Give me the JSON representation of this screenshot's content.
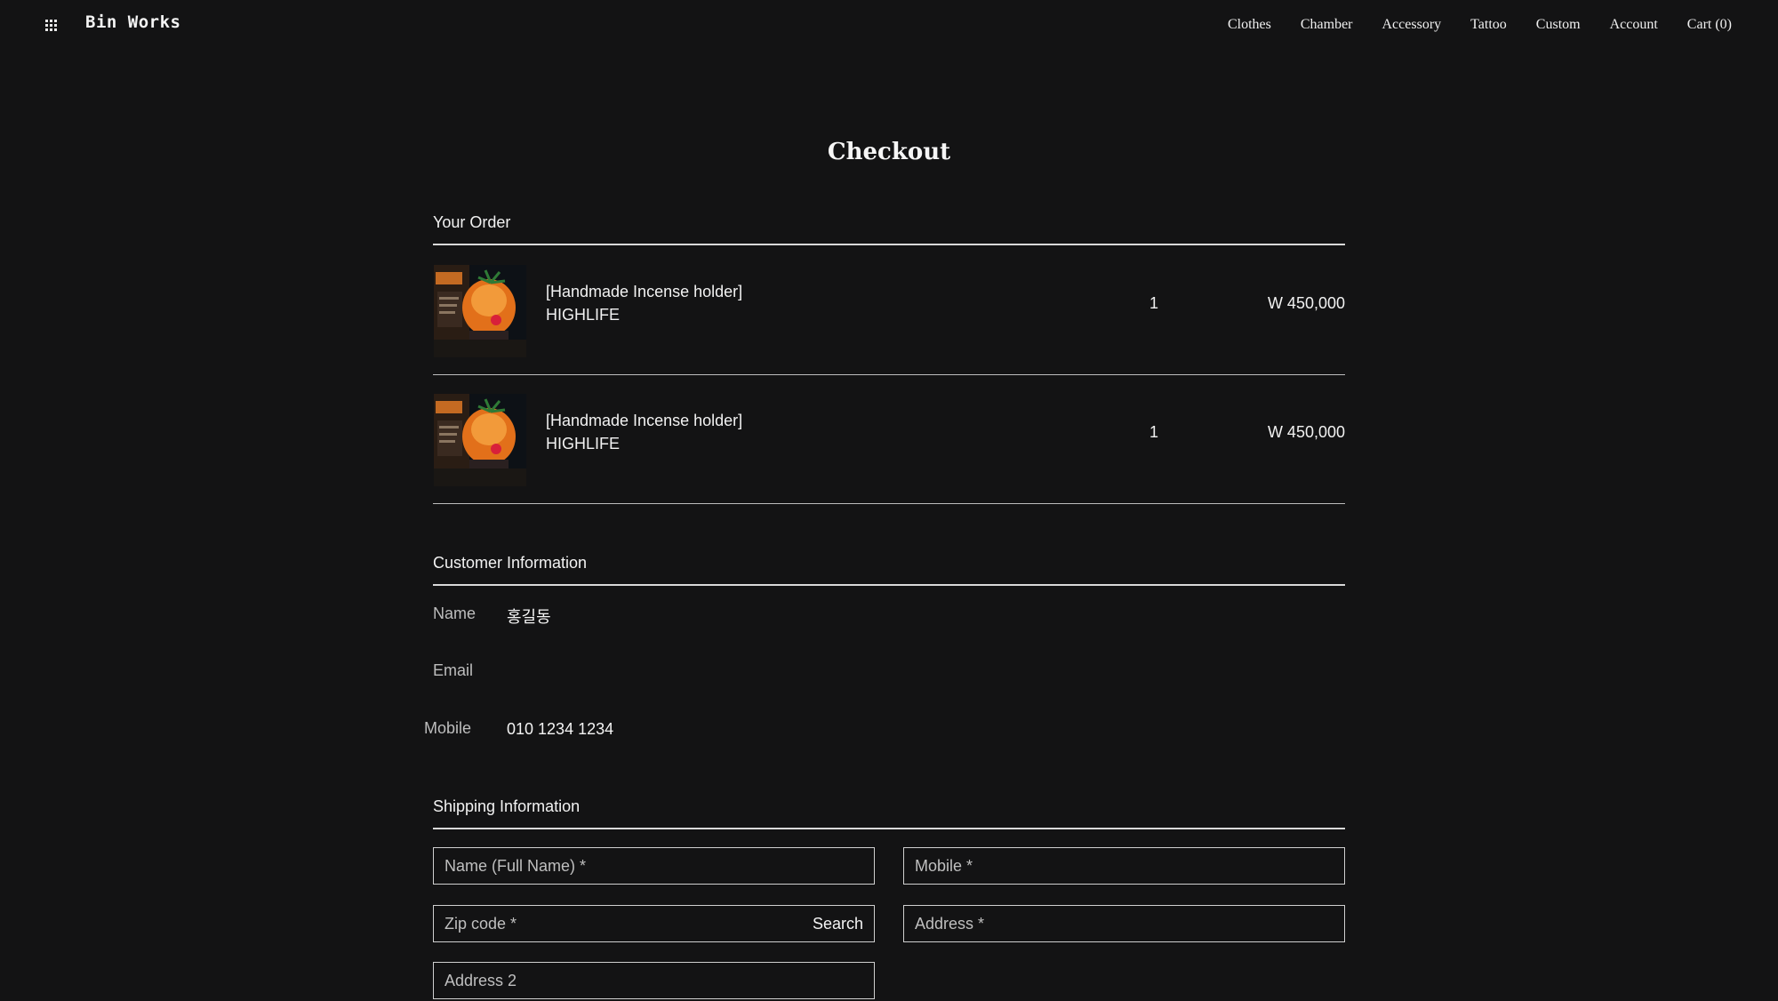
{
  "header": {
    "logo": "Bin Works",
    "menu_icon": "grid-menu-icon",
    "nav": [
      "Clothes",
      "Chamber",
      "Accessory",
      "Tattoo",
      "Custom",
      "Account",
      "Cart (0)"
    ]
  },
  "page_title": "Checkout",
  "order": {
    "title": "Your Order",
    "items": [
      {
        "name": "[Handmade Incense holder]",
        "brand": "HIGHLIFE",
        "qty": "1",
        "price": "W 450,000"
      },
      {
        "name": "[Handmade Incense holder]",
        "brand": "HIGHLIFE",
        "qty": "1",
        "price": "W 450,000"
      }
    ]
  },
  "customer": {
    "title": "Customer Information",
    "name_label": "Name",
    "name_value": "홍길동",
    "email_label": "Email",
    "email_value": "",
    "mobile_label": "Mobile",
    "mobile_value": "010 1234 1234"
  },
  "shipping": {
    "title": "Shipping Information",
    "name_placeholder": "Name (Full Name) *",
    "mobile_placeholder": "Mobile *",
    "zip_placeholder": "Zip code *",
    "search_label": "Search",
    "address_placeholder": "Address *",
    "address2_placeholder": "Address 2"
  },
  "colors": {
    "background": "#131314",
    "text": "#f2f2f2",
    "muted": "#bdbdbd",
    "border": "#d0d0d0"
  }
}
